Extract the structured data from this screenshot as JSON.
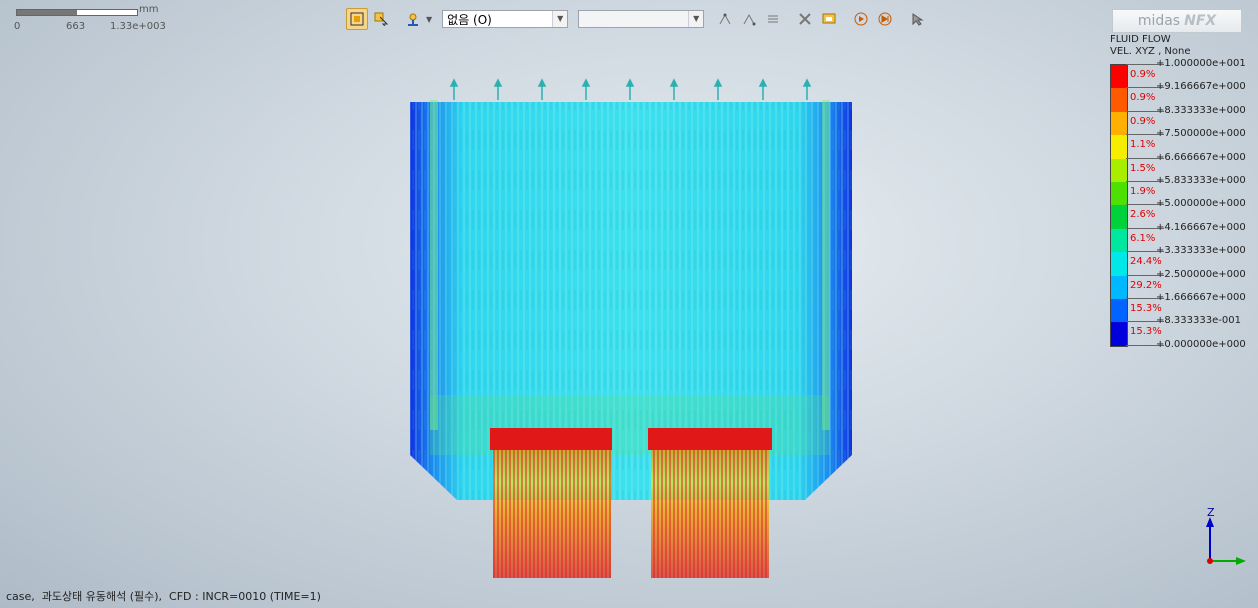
{
  "scale_bar": {
    "unit": "mm",
    "ticks": [
      "0",
      "663",
      "1.33e+003"
    ]
  },
  "toolbar": {
    "buttons": [
      {
        "name": "fit-view-icon",
        "active": true
      },
      {
        "name": "select-arrow-icon",
        "active": false
      },
      {
        "name": "view-orient-icon",
        "active": false
      }
    ],
    "combo1_value": "없음 (O)",
    "combo2_value": "",
    "buttons2": [
      "node-icon",
      "node-edit-icon",
      "list-icon",
      "clear-icon",
      "display-icon",
      "play-prev-icon",
      "play-next-icon",
      "pointer-icon"
    ]
  },
  "logo": {
    "text1": "midas",
    "text2": "NFX"
  },
  "legend": {
    "title1": "FLUID FLOW",
    "title2": "VEL. XYZ , None",
    "values": [
      "+1.000000e+001",
      "+9.166667e+000",
      "+8.333333e+000",
      "+7.500000e+000",
      "+6.666667e+000",
      "+5.833333e+000",
      "+5.000000e+000",
      "+4.166667e+000",
      "+3.333333e+000",
      "+2.500000e+000",
      "+1.666667e+000",
      "+8.333333e-001",
      "+0.000000e+000"
    ],
    "percents": [
      "0.9%",
      "0.9%",
      "0.9%",
      "1.1%",
      "1.5%",
      "1.9%",
      "2.6%",
      "6.1%",
      "24.4%",
      "29.2%",
      "15.3%",
      "15.3%"
    ],
    "colors": [
      "#ff0000",
      "#ff5a00",
      "#ffb000",
      "#f6ee00",
      "#a8ee00",
      "#4ee000",
      "#00d23c",
      "#00e8a0",
      "#00e8e8",
      "#00b8ff",
      "#0064ff",
      "#0000dc"
    ]
  },
  "axis": {
    "z": "Z"
  },
  "status": "case,  과도상태 유동해석 (필수),  CFD : INCR=0010 (TIME=1)"
}
